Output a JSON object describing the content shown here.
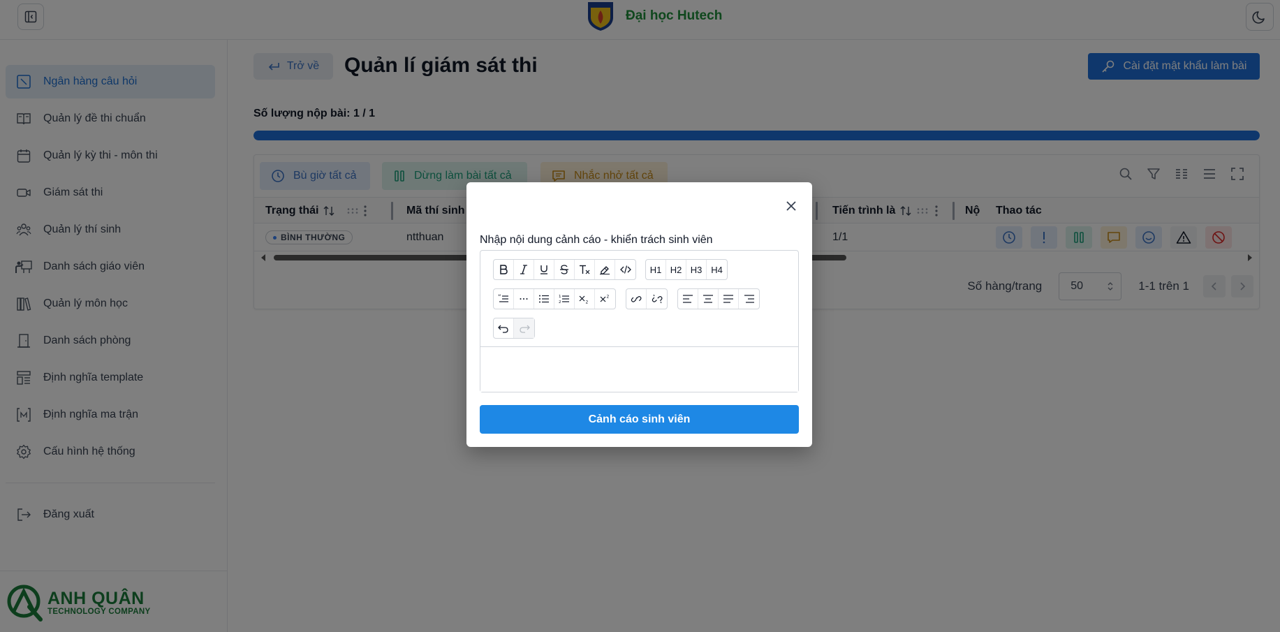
{
  "header": {
    "brand_name": "Đại học Hutech"
  },
  "sidebar": {
    "items": [
      {
        "label": "Ngân hàng câu hỏi",
        "icon": "question-bank-icon"
      },
      {
        "label": "Quản lý đề thi chuẩn",
        "icon": "book-open-icon"
      },
      {
        "label": "Quản lý kỳ thi - môn thi",
        "icon": "calendar-icon"
      },
      {
        "label": "Giám sát thi",
        "icon": "video-camera-icon"
      },
      {
        "label": "Quản lý thí sinh",
        "icon": "users-icon"
      },
      {
        "label": "Danh sách giáo viên",
        "icon": "teacher-icon"
      },
      {
        "label": "Quản lý môn học",
        "icon": "library-icon"
      },
      {
        "label": "Danh sách phòng",
        "icon": "door-icon"
      },
      {
        "label": "Định nghĩa template",
        "icon": "template-icon"
      },
      {
        "label": "Định nghĩa ma trận",
        "icon": "matrix-icon"
      },
      {
        "label": "Cấu hình hệ thống",
        "icon": "gear-icon"
      }
    ],
    "logout": "Đăng xuất",
    "company_name": "ANH QUÂN",
    "company_sub": "TECHNOLOGY COMPANY"
  },
  "main": {
    "back_label": "Trở về",
    "title": "Quản lí giám sát thi",
    "password_button": "Cài đặt mật khẩu làm bài",
    "submit_count": "Số lượng nộp bài: 1 / 1",
    "submit_progress_fraction": 1.0,
    "actions": {
      "extra_time": "Bù giờ tất cả",
      "stop_all": "Dừng làm bài tất cả",
      "remind_all": "Nhắc nhở tất cả"
    },
    "table": {
      "columns": {
        "status": "Trạng thái",
        "student_id": "Mã thí sinh",
        "progress": "Tiến trình là",
        "note": "Nộ",
        "actions": "Thao tác"
      },
      "rows": [
        {
          "status": "BÌNH THƯỜNG",
          "student_id": "ntthuan",
          "progress": "1/1"
        }
      ]
    },
    "pagination": {
      "rows_per_page_label": "Số hàng/trang",
      "rows_per_page_value": "50",
      "range": "1-1 trên 1"
    }
  },
  "modal": {
    "label": "Nhập nội dung cảnh cáo - khiển trách sinh viên",
    "submit": "Cảnh cáo sinh viên",
    "toolbar": {
      "row1_group1": [
        "B",
        "I",
        "U",
        "S",
        "Tx",
        "highlight",
        "code"
      ],
      "row1_group2": [
        "H1",
        "H2",
        "H3",
        "H4"
      ]
    }
  },
  "colors": {
    "primary": "#1e6fd9",
    "brand_green": "#1f8f3a",
    "warn_button": "#1e88e5"
  }
}
